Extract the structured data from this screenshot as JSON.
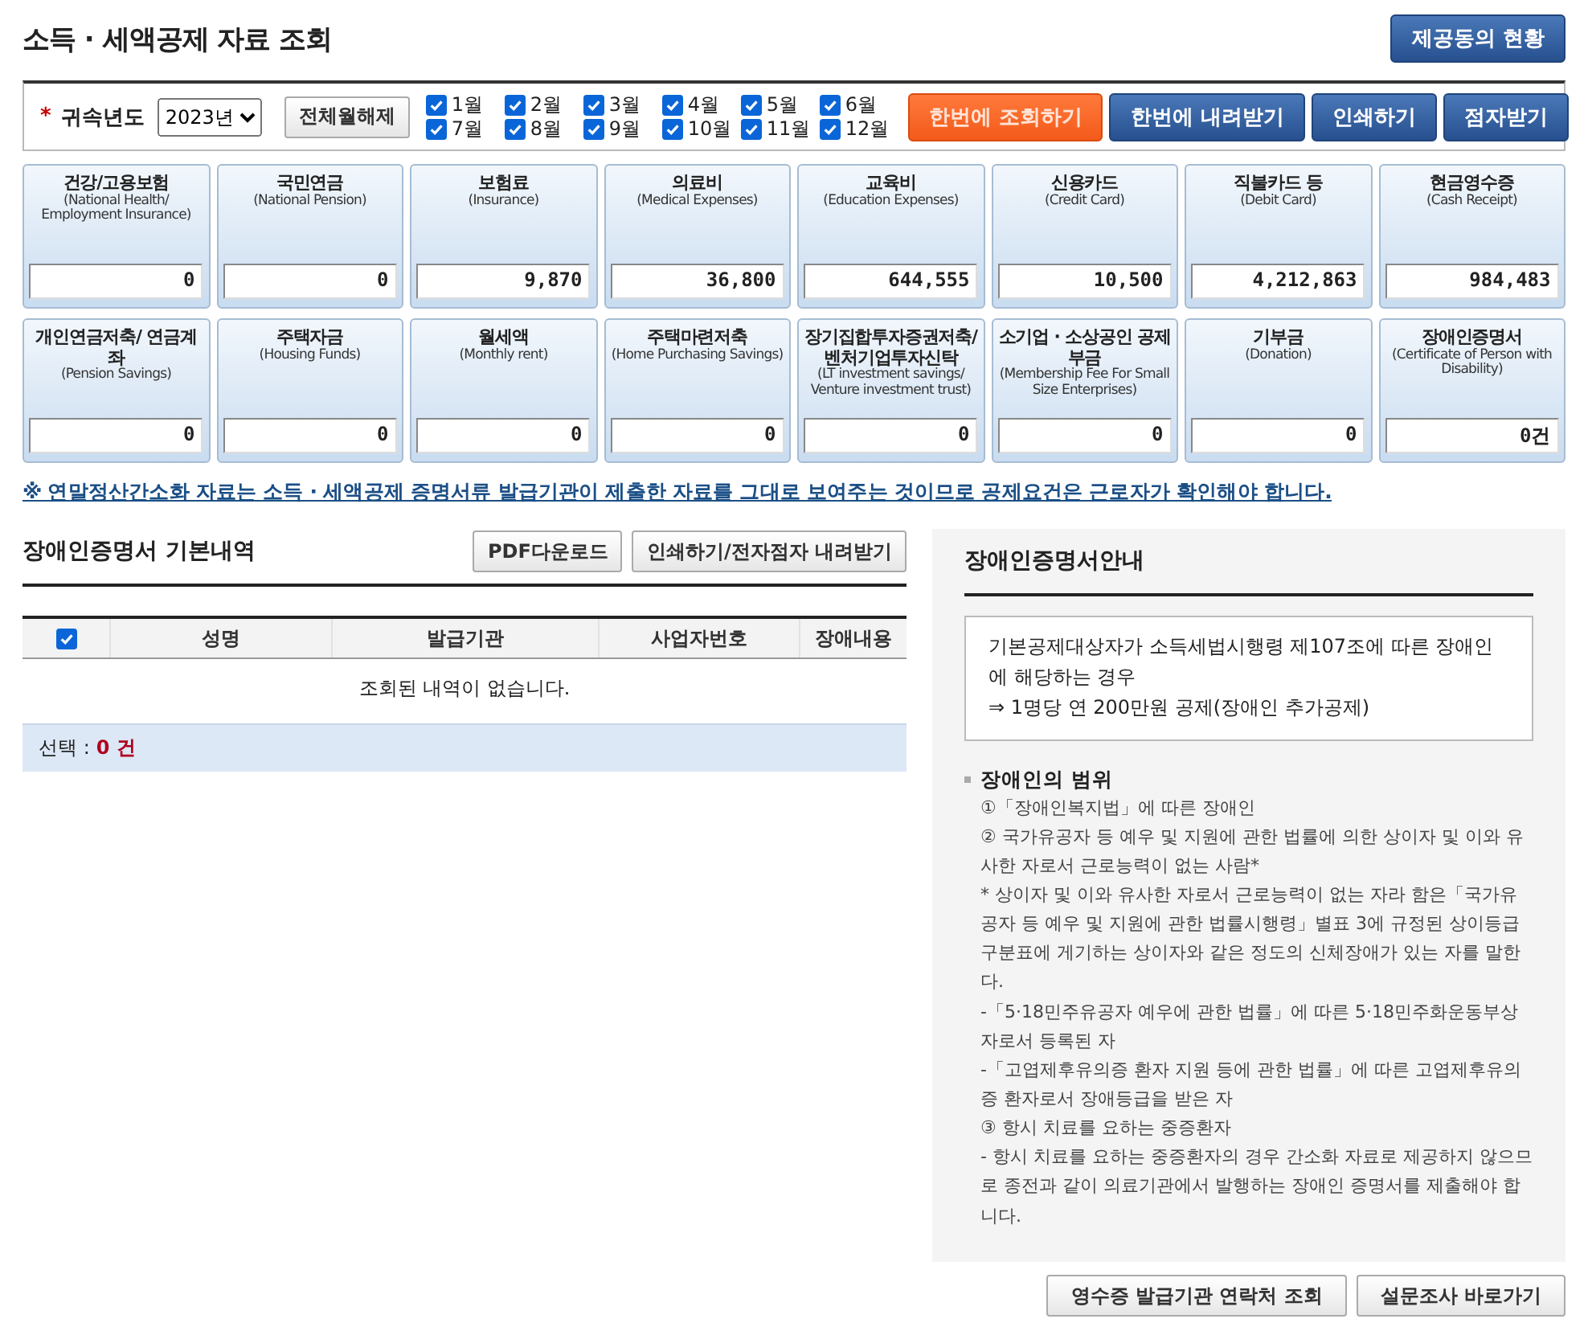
{
  "title": "소득 · 세액공제 자료 조회",
  "consent_button": "제공동의 현황",
  "filter": {
    "year_label": "귀속년도",
    "required_mark": "*",
    "year": "2023년",
    "clear_button": "전체월해제",
    "months": [
      {
        "label": "1월",
        "checked": true
      },
      {
        "label": "2월",
        "checked": true
      },
      {
        "label": "3월",
        "checked": true
      },
      {
        "label": "4월",
        "checked": true
      },
      {
        "label": "5월",
        "checked": true
      },
      {
        "label": "6월",
        "checked": true
      },
      {
        "label": "7월",
        "checked": true
      },
      {
        "label": "8월",
        "checked": true
      },
      {
        "label": "9월",
        "checked": true
      },
      {
        "label": "10월",
        "checked": true
      },
      {
        "label": "11월",
        "checked": true
      },
      {
        "label": "12월",
        "checked": true
      }
    ],
    "actions": [
      {
        "label": "한번에 조회하기",
        "kind": "primary"
      },
      {
        "label": "한번에 내려받기",
        "kind": "normal"
      },
      {
        "label": "인쇄하기",
        "kind": "normal"
      },
      {
        "label": "점자받기",
        "kind": "normal"
      }
    ]
  },
  "cards": [
    {
      "label": "건강/고용보험",
      "sub": "(National Health/ Employment Insurance)",
      "value": "0"
    },
    {
      "label": "국민연금",
      "sub": "(National Pension)",
      "value": "0"
    },
    {
      "label": "보험료",
      "sub": "(Insurance)",
      "value": "9,870"
    },
    {
      "label": "의료비",
      "sub": "(Medical Expenses)",
      "value": "36,800"
    },
    {
      "label": "교육비",
      "sub": "(Education Expenses)",
      "value": "644,555"
    },
    {
      "label": "신용카드",
      "sub": "(Credit Card)",
      "value": "10,500"
    },
    {
      "label": "직불카드 등",
      "sub": "(Debit Card)",
      "value": "4,212,863"
    },
    {
      "label": "현금영수증",
      "sub": "(Cash Receipt)",
      "value": "984,483"
    },
    {
      "label": "개인연금저축/ 연금계좌",
      "sub": "(Pension Savings)",
      "value": "0"
    },
    {
      "label": "주택자금",
      "sub": "(Housing Funds)",
      "value": "0"
    },
    {
      "label": "월세액",
      "sub": "(Monthly rent)",
      "value": "0"
    },
    {
      "label": "주택마련저축",
      "sub": "(Home Purchasing Savings)",
      "value": "0"
    },
    {
      "label": "장기집합투자증권저축/ 벤처기업투자신탁",
      "sub": "(LT investment savings/ Venture investment trust)",
      "value": "0"
    },
    {
      "label": "소기업 · 소상공인 공제부금",
      "sub": "(Membership Fee For Small Size Enterprises)",
      "value": "0"
    },
    {
      "label": "기부금",
      "sub": "(Donation)",
      "value": "0"
    },
    {
      "label": "장애인증명서",
      "sub": "(Certificate of Person with Disability)",
      "value": "0건"
    }
  ],
  "notice": "※ 연말정산간소화 자료는 소득 · 세액공제 증명서류 발급기관이 제출한 자료를 그대로 보여주는 것이므로 공제요건은 근로자가 확인해야 합니다.",
  "detail": {
    "title": "장애인증명서 기본내역",
    "buttons": [
      "PDF다운로드",
      "인쇄하기/전자점자 내려받기"
    ],
    "table": {
      "select_all": true,
      "columns": [
        "성명",
        "발급기관",
        "사업자번호",
        "장애내용"
      ],
      "empty": "조회된 내역이 없습니다."
    },
    "selection_label": "선택 :",
    "selection_count": "0 건"
  },
  "guide": {
    "title": "장애인증명서안내",
    "box": [
      "기본공제대상자가 소득세법시행령 제107조에 따른 장애인에 해당하는 경우",
      "⇒ 1명당 연 200만원 공제(장애인 추가공제)"
    ],
    "scope_title": "장애인의 범위",
    "items": [
      "①「장애인복지법」에 따른 장애인",
      "② 국가유공자 등 예우 및 지원에 관한 법률에 의한 상이자 및 이와 유사한 자로서 근로능력이 없는 사람*",
      "* 상이자 및 이와 유사한 자로서 근로능력이 없는 자라 함은「국가유공자 등 예우 및 지원에 관한 법률시행령」별표 3에 규정된 상이등급 구분표에 게기하는 상이자와 같은 정도의 신체장애가 있는 자를 말한다.",
      "-「5·18민주유공자 예우에 관한 법률」에 따른 5·18민주화운동부상자로서 등록된 자",
      "-「고엽제후유의증 환자 지원 등에 관한 법률」에 따른 고엽제후유의증 환자로서 장애등급을 받은 자",
      "③ 항시 치료를 요하는 중증환자",
      "- 항시 치료를 요하는 중증환자의 경우 간소화 자료로 제공하지 않으므로 종전과 같이 의료기관에서 발행하는 장애인 증명서를 제출해야 합니다."
    ]
  },
  "footer_buttons": [
    "영수증 발급기관 연락처 조회",
    "설문조사 바로가기"
  ]
}
